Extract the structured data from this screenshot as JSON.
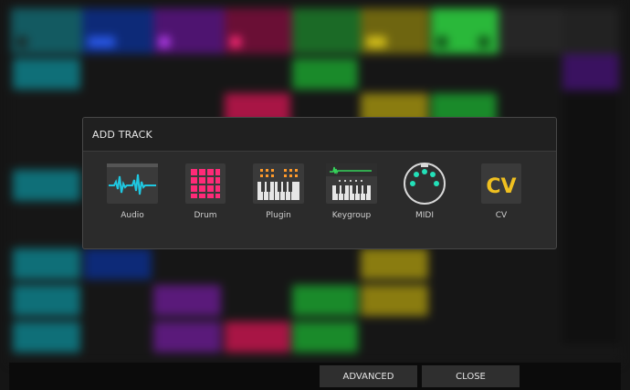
{
  "dialog": {
    "title": "ADD TRACK",
    "options": [
      {
        "label": "Audio",
        "icon": "audio-waveform-icon"
      },
      {
        "label": "Drum",
        "icon": "drum-pads-icon"
      },
      {
        "label": "Plugin",
        "icon": "plugin-keyboard-icon"
      },
      {
        "label": "Keygroup",
        "icon": "keygroup-keyboard-icon"
      },
      {
        "label": "MIDI",
        "icon": "midi-port-icon"
      },
      {
        "label": "CV",
        "icon": "cv-icon"
      }
    ]
  },
  "buttons": {
    "advanced": "ADVANCED",
    "close": "CLOSE"
  },
  "colors": {
    "cyan": "#1fc7e0",
    "pink": "#ff2a78",
    "orange": "#ff9a2a",
    "green": "#35d35a",
    "teal": "#23e0b8",
    "yellow": "#f0c020"
  }
}
